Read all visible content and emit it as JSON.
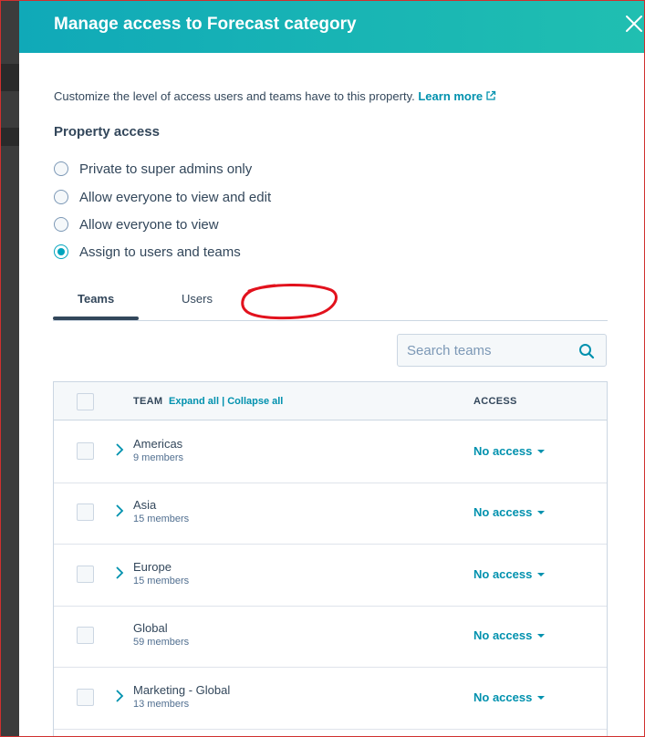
{
  "modal": {
    "title": "Manage access to Forecast category",
    "intro_text": "Customize the level of access users and teams have to this property.",
    "learn_more": "Learn more",
    "section_label": "Property access"
  },
  "options": [
    {
      "label": "Private to super admins only",
      "selected": false
    },
    {
      "label": "Allow everyone to view and edit",
      "selected": false
    },
    {
      "label": "Allow everyone to view",
      "selected": false
    },
    {
      "label": "Assign to users and teams",
      "selected": true
    }
  ],
  "tabs": [
    {
      "label": "Teams",
      "active": true
    },
    {
      "label": "Users",
      "active": false
    }
  ],
  "search": {
    "placeholder": "Search teams"
  },
  "table": {
    "team_header": "TEAM",
    "expand_all": "Expand all",
    "separator": "|",
    "collapse_all": "Collapse all",
    "access_header": "ACCESS",
    "rows": [
      {
        "name": "Americas",
        "members": "9 members",
        "access": "No access",
        "expandable": true
      },
      {
        "name": "Asia",
        "members": "15 members",
        "access": "No access",
        "expandable": true
      },
      {
        "name": "Europe",
        "members": "15 members",
        "access": "No access",
        "expandable": true
      },
      {
        "name": "Global",
        "members": "59 members",
        "access": "No access",
        "expandable": false
      },
      {
        "name": "Marketing - Global",
        "members": "13 members",
        "access": "No access",
        "expandable": true
      }
    ]
  },
  "icons": {
    "close": "close-icon",
    "external": "external-link-icon",
    "search": "search-icon",
    "expand": "chevron-right-icon",
    "dropdown": "caret-down-icon"
  },
  "colors": {
    "header_start": "#10a9b8",
    "header_end": "#20bfb1",
    "accent": "#00a4bd",
    "link": "#0091ae",
    "text": "#33475b",
    "annotation": "#e2121d"
  }
}
